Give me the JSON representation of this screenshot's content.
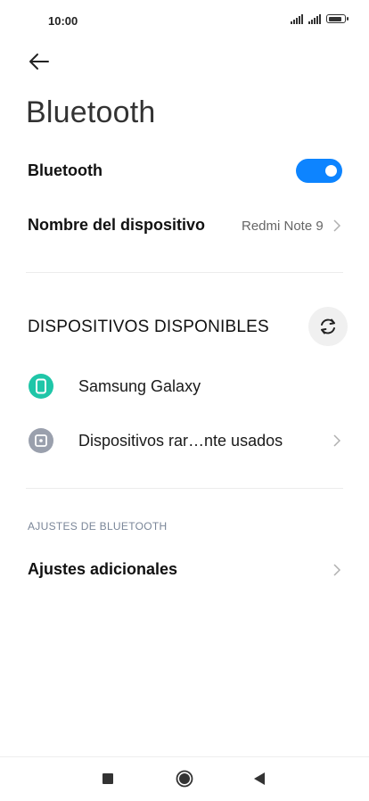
{
  "status_bar": {
    "time": "10:00"
  },
  "header": {
    "title": "Bluetooth"
  },
  "settings": {
    "bluetooth_label": "Bluetooth",
    "bluetooth_enabled": true,
    "device_name_label": "Nombre del dispositivo",
    "device_name_value": "Redmi Note 9"
  },
  "available": {
    "section_title": "DISPOSITIVOS DISPONIBLES",
    "devices": [
      {
        "label": "Samsung Galaxy",
        "icon": "phone-icon",
        "color": "#1fc6a8"
      },
      {
        "label": "Dispositivos rar…nte usados",
        "icon": "square-dot-icon",
        "color": "#9aa0ad"
      }
    ]
  },
  "bt_settings": {
    "section_title": "AJUSTES DE BLUETOOTH",
    "additional_label": "Ajustes adicionales"
  },
  "colors": {
    "accent": "#0d84ff"
  }
}
